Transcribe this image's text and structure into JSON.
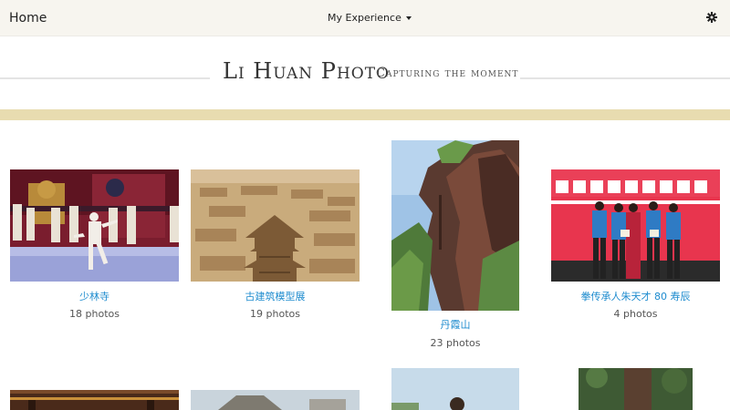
{
  "nav": {
    "home_label": "Home",
    "menu_label": "My Experience",
    "settings_icon": "gear-icon"
  },
  "header": {
    "title": "Li Huan Photo",
    "tagline": "Capturing the moment"
  },
  "colors": {
    "navbar_bg": "#f7f5ef",
    "accent_band": "#e8dcb0",
    "link": "#1f8ccf",
    "count_text": "#555555"
  },
  "albums": [
    {
      "title": "少林寺",
      "count": "18 photos"
    },
    {
      "title": "古建筑模型展",
      "count": "19 photos"
    },
    {
      "title": "丹霞山",
      "count": "23 photos"
    },
    {
      "title": "拳传承人朱天才 80 寿辰",
      "count": "4 photos"
    }
  ]
}
